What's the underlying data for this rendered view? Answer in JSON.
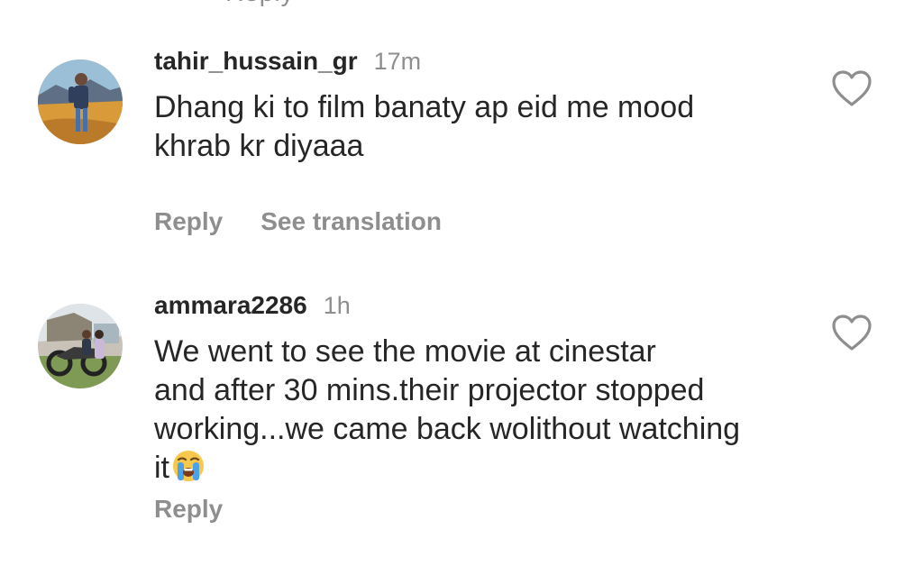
{
  "cropped_top": {
    "label": "Reply"
  },
  "comments": [
    {
      "username": "tahir_hussain_gr",
      "time": "17m",
      "text": "Dhang ki to film banaty ap eid me mood\nkhrab kr diyaaa",
      "reply_label": "Reply",
      "translation_label": "See translation",
      "like_icon": "heart-outline-icon",
      "avatar_icon": "profile-photo-man-standing-outdoors"
    },
    {
      "username": "ammara2286",
      "time": "1h",
      "text": "We went to see the movie at cinestar\nand after 30 mins.their projector stopped\nworking...we came back wolithout watching\nit",
      "emoji_icon": "loudly-crying-face-emoji-icon",
      "reply_label": "Reply",
      "like_icon": "heart-outline-icon",
      "avatar_icon": "profile-photo-couple-with-motorcycle"
    }
  ],
  "colors": {
    "primary_text": "#262626",
    "secondary_text": "#8e8e8e",
    "background": "#ffffff"
  }
}
